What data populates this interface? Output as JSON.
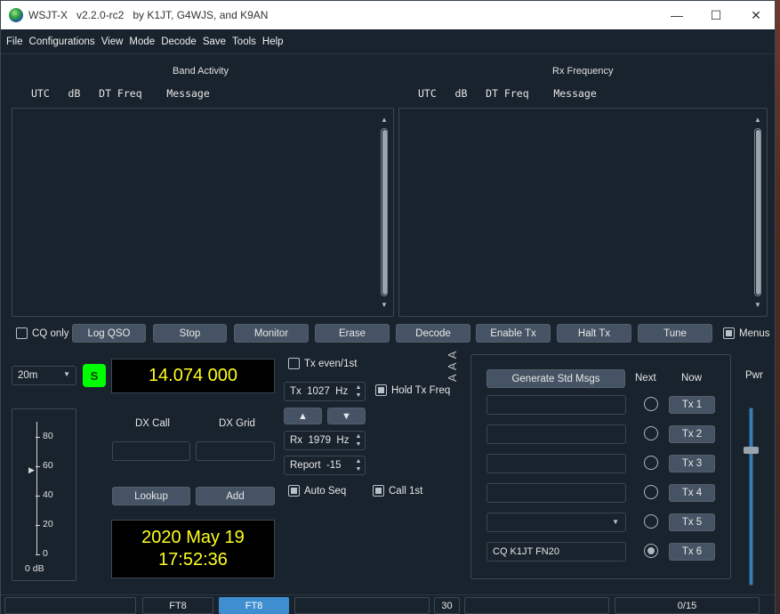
{
  "window": {
    "title": "WSJT-X   v2.2.0-rc2   by K1JT, G4WJS, and K9AN",
    "controls": {
      "minimize": "—",
      "maximize": "☐",
      "close": "✕"
    }
  },
  "menu": [
    "File",
    "Configurations",
    "View",
    "Mode",
    "Decode",
    "Save",
    "Tools",
    "Help"
  ],
  "band_activity": {
    "title": "Band Activity",
    "columns": "UTC   dB   DT Freq    Message"
  },
  "rx_frequency": {
    "title": "Rx Frequency",
    "columns": "UTC   dB   DT Freq    Message"
  },
  "controls_row": {
    "cq_only": "CQ only",
    "log_qso": "Log QSO",
    "stop": "Stop",
    "monitor": "Monitor",
    "erase": "Erase",
    "decode": "Decode",
    "enable_tx": "Enable Tx",
    "halt_tx": "Halt Tx",
    "tune": "Tune",
    "menus": "Menus"
  },
  "band": {
    "selected": "20m"
  },
  "s_indicator": "S",
  "dial_frequency": "14.074 000",
  "meter": {
    "ticks": [
      "80",
      "60",
      "40",
      "20",
      "0"
    ],
    "unit_label": "0 dB",
    "level_db": 60
  },
  "dx": {
    "call_label": "DX Call",
    "grid_label": "DX Grid",
    "lookup": "Lookup",
    "add": "Add"
  },
  "clock": {
    "date": "2020 May 19",
    "time": "17:52:36"
  },
  "tx_settings": {
    "tx_even": "Tx even/1st",
    "tx_freq": "Tx  1027  Hz",
    "hold_tx_freq": "Hold Tx Freq",
    "up_arrow": "▲",
    "down_arrow": "▼",
    "rx_freq": "Rx  1979  Hz",
    "report": "Report  -15",
    "auto_seq": "Auto Seq",
    "call_1st": "Call 1st",
    "font_glyphs": "A A A"
  },
  "messages": {
    "generate": "Generate Std Msgs",
    "next_label": "Next",
    "now_label": "Now",
    "rows": [
      {
        "text": "",
        "button": "Tx 1"
      },
      {
        "text": "",
        "button": "Tx 2"
      },
      {
        "text": "",
        "button": "Tx 3"
      },
      {
        "text": "",
        "button": "Tx 4"
      },
      {
        "text": "",
        "button": "Tx 5"
      },
      {
        "text": "CQ K1JT FN20",
        "button": "Tx 6"
      }
    ]
  },
  "pwr_label": "Pwr",
  "statusbar": {
    "mode1": "FT8",
    "mode2": "FT8",
    "period": "30",
    "progress": "0/15"
  },
  "colors": {
    "background": "#19232d",
    "button": "#455364",
    "display_text": "#ffff1e",
    "s_indicator": "#00ff00"
  }
}
